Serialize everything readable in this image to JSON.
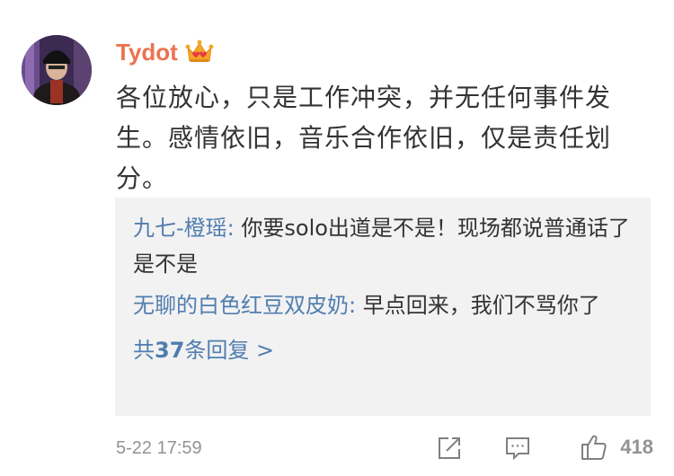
{
  "comment": {
    "username": "Tydot",
    "text": "各位放心，只是工作冲突，并无任何事件发生。感情依旧，音乐合作依旧，仅是责任划分。",
    "timestamp": "5-22 17:59",
    "like_count": "418"
  },
  "replies": [
    {
      "user": "九七-橙瑶",
      "text": " 你要solo出道是不是！现场都说普通话了是不是"
    },
    {
      "user": "无聊的白色红豆双皮奶",
      "text": " 早点回来，我们不骂你了"
    }
  ],
  "more_replies": {
    "prefix": "共",
    "count": "37",
    "suffix": "条回复 >"
  },
  "colors": {
    "username": "#eb7350",
    "link": "#507daf",
    "reply_bg": "#f2f2f2",
    "muted": "#939393"
  }
}
